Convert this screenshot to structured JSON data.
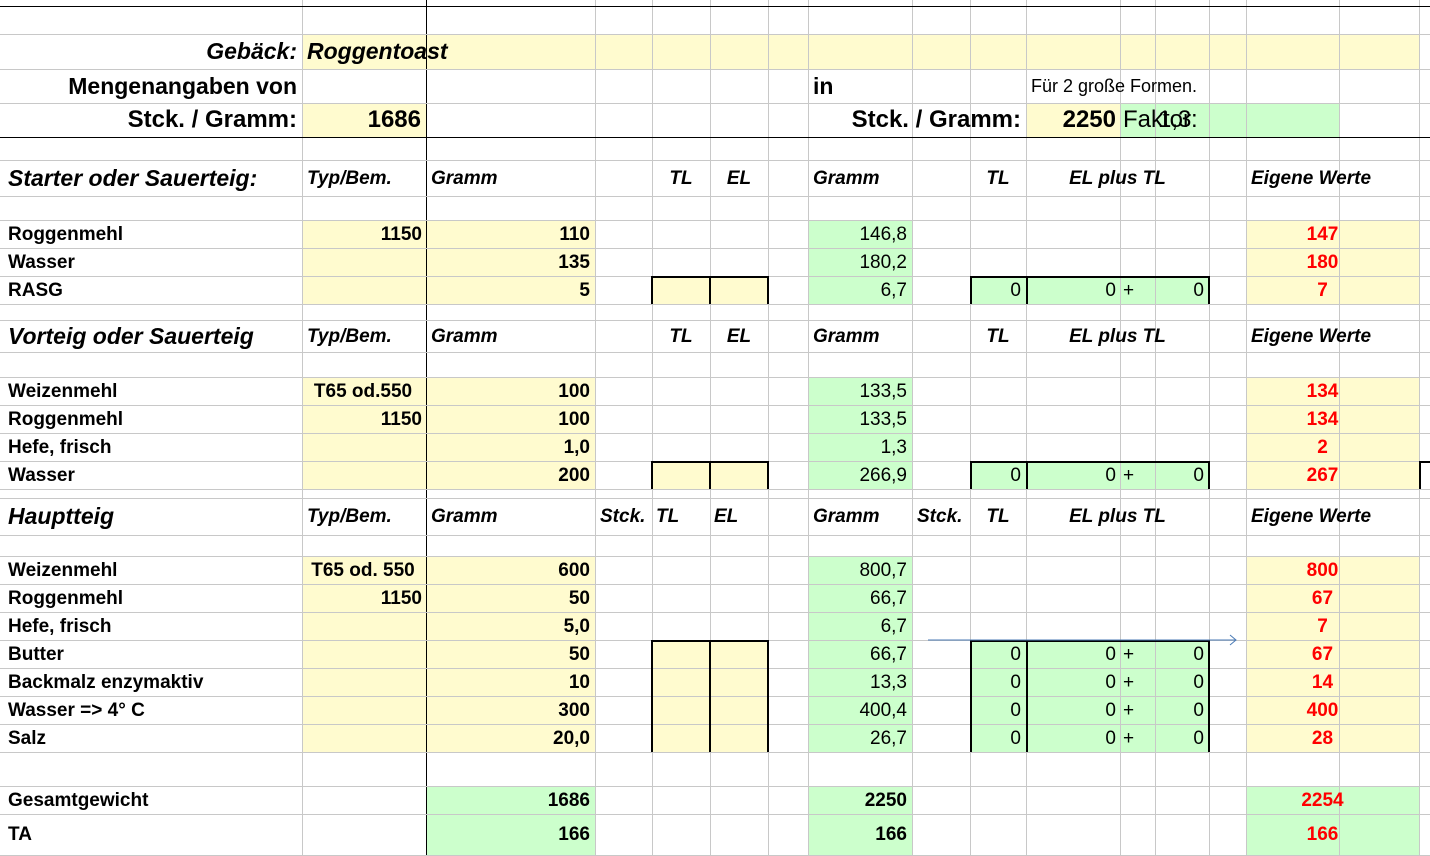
{
  "header": {
    "gebaeck_label": "Gebäck:",
    "gebaeck_value": "Roggentoast",
    "mengen_label": "Mengenangaben von",
    "in_label": "in",
    "note": "Für 2 große Formen.",
    "stck_label_left": "Stck. / Gramm:",
    "stck_value_left": "1686",
    "stck_label_right": "Stck. / Gramm:",
    "stck_value_right": "2250",
    "faktor_label": "Faktor:",
    "faktor_value": "1,3"
  },
  "columns": {
    "typ": "Typ/Bem.",
    "gramm": "Gramm",
    "stck": "Stck.",
    "tl": "TL",
    "el": "EL",
    "el_plus_tl": "EL plus TL",
    "eigene": "Eigene Werte"
  },
  "sections": [
    {
      "title": "Starter oder Sauerteig:",
      "rows": [
        {
          "name": "Roggenmehl",
          "typ": "1150",
          "gramm": "110",
          "gramm2": "146,8",
          "eigene": "147"
        },
        {
          "name": "Wasser",
          "typ": "",
          "gramm": "135",
          "gramm2": "180,2",
          "eigene": "180"
        },
        {
          "name": "RASG",
          "typ": "",
          "gramm": "5",
          "gramm2": "6,7",
          "tl2": "0",
          "el2": "0",
          "plus": "+",
          "tl3": "0",
          "eigene": "7"
        }
      ]
    },
    {
      "title": "Vorteig oder Sauerteig",
      "rows": [
        {
          "name": "Weizenmehl",
          "typ": "T65 od.550",
          "gramm": "100",
          "gramm2": "133,5",
          "eigene": "134"
        },
        {
          "name": "Roggenmehl",
          "typ": "1150",
          "gramm": "100",
          "gramm2": "133,5",
          "eigene": "134"
        },
        {
          "name": "Hefe, frisch",
          "typ": "",
          "gramm": "1,0",
          "gramm2": "1,3",
          "eigene": "2"
        },
        {
          "name": "Wasser",
          "typ": "",
          "gramm": "200",
          "gramm2": "266,9",
          "tl2": "0",
          "el2": "0",
          "plus": "+",
          "tl3": "0",
          "eigene": "267"
        }
      ]
    },
    {
      "title": "Hauptteig",
      "rows": [
        {
          "name": "Weizenmehl",
          "typ": "T65 od. 550",
          "gramm": "600",
          "gramm2": "800,7",
          "eigene": "800"
        },
        {
          "name": "Roggenmehl",
          "typ": "1150",
          "gramm": "50",
          "gramm2": "66,7",
          "eigene": "67"
        },
        {
          "name": "Hefe, frisch",
          "typ": "",
          "gramm": "5,0",
          "gramm2": "6,7",
          "eigene": "7"
        },
        {
          "name": "Butter",
          "typ": "",
          "gramm": "50",
          "gramm2": "66,7",
          "tl2": "0",
          "el2": "0",
          "plus": "+",
          "tl3": "0",
          "eigene": "67"
        },
        {
          "name": "Backmalz enzymaktiv",
          "typ": "",
          "gramm": "10",
          "gramm2": "13,3",
          "tl2": "0",
          "el2": "0",
          "plus": "+",
          "tl3": "0",
          "eigene": "14"
        },
        {
          "name": "Wasser => 4° C",
          "typ": "",
          "gramm": "300",
          "gramm2": "400,4",
          "tl2": "0",
          "el2": "0",
          "plus": "+",
          "tl3": "0",
          "eigene": "400"
        },
        {
          "name": "Salz",
          "typ": "",
          "gramm": "20,0",
          "gramm2": "26,7",
          "tl2": "0",
          "el2": "0",
          "plus": "+",
          "tl3": "0",
          "eigene": "28"
        }
      ]
    }
  ],
  "totals": {
    "gesamt_label": "Gesamtgewicht",
    "gesamt_gramm": "1686",
    "gesamt_gramm2": "2250",
    "gesamt_eigene": "2254",
    "ta_label": "TA",
    "ta_gramm": "166",
    "ta_gramm2": "166",
    "ta_eigene": "166"
  }
}
